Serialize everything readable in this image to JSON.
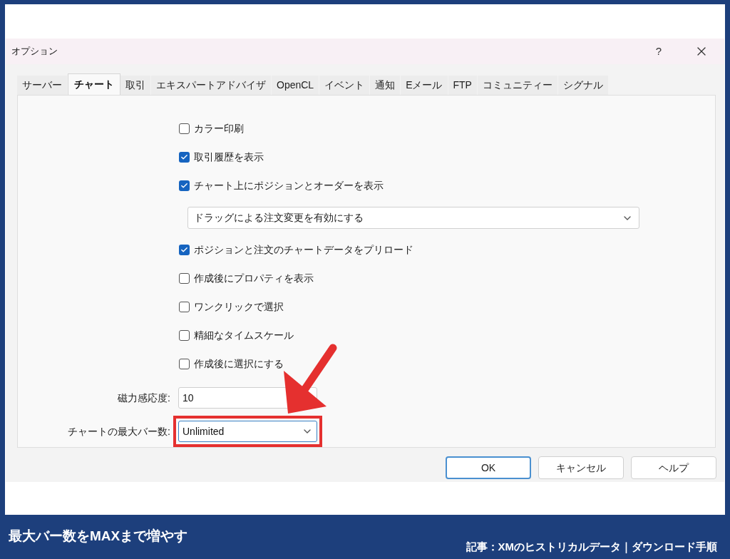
{
  "dialog": {
    "title": "オプション",
    "help": "?"
  },
  "tabs": [
    {
      "label": "サーバー",
      "selected": false
    },
    {
      "label": "チャート",
      "selected": true
    },
    {
      "label": "取引",
      "selected": false
    },
    {
      "label": "エキスパートアドバイザ",
      "selected": false
    },
    {
      "label": "OpenCL",
      "selected": false
    },
    {
      "label": "イベント",
      "selected": false
    },
    {
      "label": "通知",
      "selected": false
    },
    {
      "label": "Eメール",
      "selected": false
    },
    {
      "label": "FTP",
      "selected": false
    },
    {
      "label": "コミュニティー",
      "selected": false
    },
    {
      "label": "シグナル",
      "selected": false
    }
  ],
  "options": [
    {
      "kind": "checkbox",
      "label": "カラー印刷",
      "checked": false
    },
    {
      "kind": "checkbox",
      "label": "取引履歴を表示",
      "checked": true
    },
    {
      "kind": "checkbox",
      "label": "チャート上にポジションとオーダーを表示",
      "checked": true
    },
    {
      "kind": "dropdown",
      "value": "ドラッグによる注文変更を有効にする"
    },
    {
      "kind": "checkbox",
      "label": "ポジションと注文のチャートデータをプリロード",
      "checked": true
    },
    {
      "kind": "checkbox",
      "label": "作成後にプロパティを表示",
      "checked": false
    },
    {
      "kind": "checkbox",
      "label": "ワンクリックで選択",
      "checked": false
    },
    {
      "kind": "checkbox",
      "label": "精細なタイムスケール",
      "checked": false
    },
    {
      "kind": "checkbox",
      "label": "作成後に選択にする",
      "checked": false
    }
  ],
  "fields": [
    {
      "kind": "input",
      "label": "磁力感応度:",
      "value": "10",
      "highlighted": false
    },
    {
      "kind": "select",
      "label": "チャートの最大バー数:",
      "value": "Unlimited",
      "highlighted": true
    }
  ],
  "buttons": [
    {
      "label": "OK",
      "default": true
    },
    {
      "label": "キャンセル",
      "default": false
    },
    {
      "label": "ヘルプ",
      "default": false
    }
  ],
  "caption": {
    "title": "最大バー数をMAXまで増やす",
    "source": "記事：XMのヒストリカルデータ｜ダウンロード手順"
  }
}
